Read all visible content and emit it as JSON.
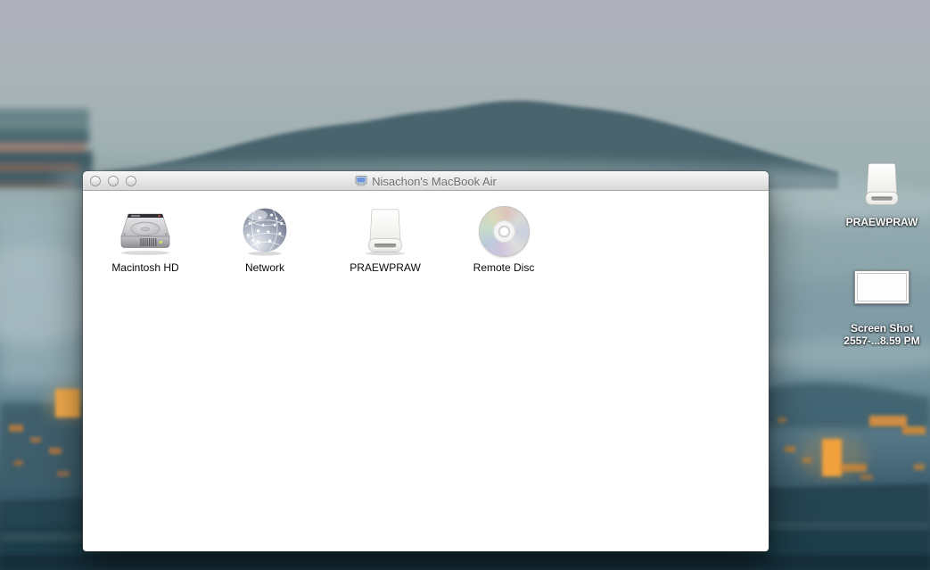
{
  "window": {
    "title": "Nisachon's MacBook Air",
    "traffic_lights": [
      "close",
      "minimize",
      "zoom"
    ],
    "volumes": [
      {
        "label": "Macintosh HD",
        "icon": "internal-hard-drive-icon"
      },
      {
        "label": "Network",
        "icon": "network-globe-icon"
      },
      {
        "label": "PRAEWPRAW",
        "icon": "external-drive-icon"
      },
      {
        "label": "Remote Disc",
        "icon": "optical-disc-icon"
      }
    ]
  },
  "desktop": {
    "icons": [
      {
        "label": "PRAEWPRAW",
        "icon": "external-drive-icon"
      },
      {
        "label_line1": "Screen Shot",
        "label_line2": "2557-...8.59 PM",
        "icon": "image-thumbnail-icon"
      }
    ]
  },
  "colors": {
    "titlebar_top": "#f6f6f6",
    "titlebar_bottom": "#d8d8d8",
    "title_text": "#6f6f6f",
    "window_background": "#ffffff",
    "volume_label_text": "#0a0a0a",
    "desktop_label_text": "#ffffff",
    "sky_top": "#aeafba",
    "mountain_teal": "#44616b",
    "city_light_orange": "#f2a23c",
    "bottom_dark_teal": "#1a3846",
    "computer_icon_screen_blue": "#6c95dd"
  }
}
